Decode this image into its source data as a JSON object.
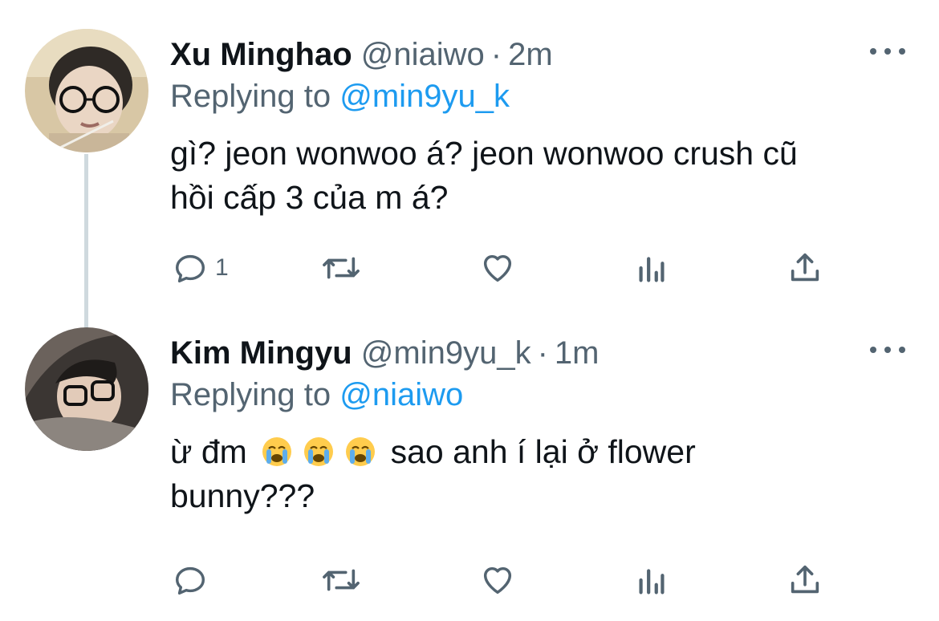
{
  "thread": [
    {
      "display_name": "Xu Minghao",
      "handle": "@niaiwo",
      "separator": "·",
      "time": "2m",
      "replying_prefix": "Replying to",
      "replying_to": "@min9yu_k",
      "text": "gì? jeon wonwoo á? jeon wonwoo crush cũ\nhồi cấp 3 của m á?",
      "reply_count": "1"
    },
    {
      "display_name": "Kim Mingyu",
      "handle": "@min9yu_k",
      "separator": "·",
      "time": "1m",
      "replying_prefix": "Replying to",
      "replying_to": "@niaiwo",
      "text_before_emoji": "ừ đm",
      "emojis": [
        "loudly-crying-face",
        "loudly-crying-face",
        "loudly-crying-face"
      ],
      "text_after_emoji": "sao anh í lại ở flower\nbunny???",
      "reply_count": ""
    }
  ],
  "colors": {
    "text": "#0f1419",
    "secondary": "#536471",
    "link": "#1d9bf0",
    "thread_line": "#cfd9de"
  }
}
